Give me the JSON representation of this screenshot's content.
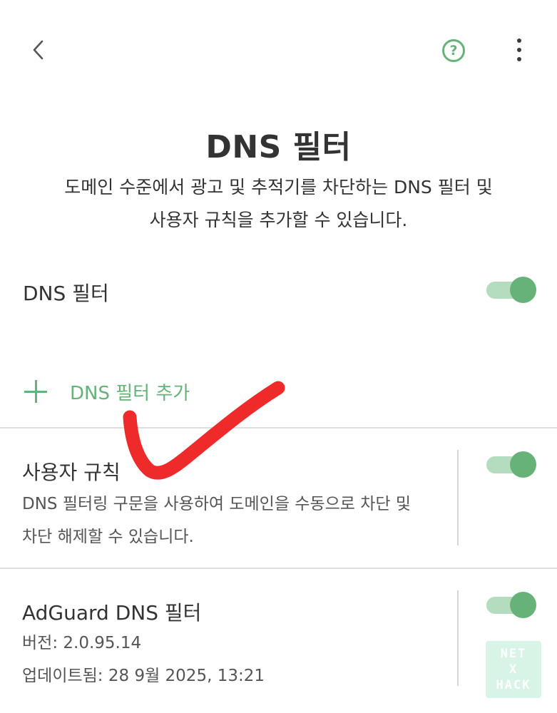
{
  "header": {
    "title": "DNS 필터",
    "subtitle_line1": "도메인 수준에서 광고 및 추적기를 차단하는 DNS 필터 및",
    "subtitle_line2": "사용자 규칙을 추가할 수 있습니다."
  },
  "toolbar": {
    "back_icon": "chevron-left-icon",
    "help_icon": "help-circle-icon",
    "help_glyph": "?",
    "more_icon": "more-vertical-icon"
  },
  "dns_filter": {
    "label": "DNS 필터",
    "enabled": true
  },
  "add_filter": {
    "label": "DNS 필터 추가"
  },
  "user_rules": {
    "title": "사용자 규칙",
    "desc_line1": "DNS 필터링 구문을 사용하여 도메인을 수동으로 차단 및",
    "desc_line2": "차단 해제할 수 있습니다.",
    "enabled": true
  },
  "adguard_filter": {
    "title": "AdGuard DNS 필터",
    "version": "버전: 2.0.95.14",
    "updated": "업데이트됨: 28 9월 2025, 13:21",
    "enabled": true
  },
  "watermark": {
    "line1": "NET",
    "line2": "X",
    "line3": "HACK"
  },
  "colors": {
    "accent": "#67b279",
    "accent_light": "#b4dcbe",
    "text": "#333333",
    "annotation_red": "#ee2a2a"
  }
}
